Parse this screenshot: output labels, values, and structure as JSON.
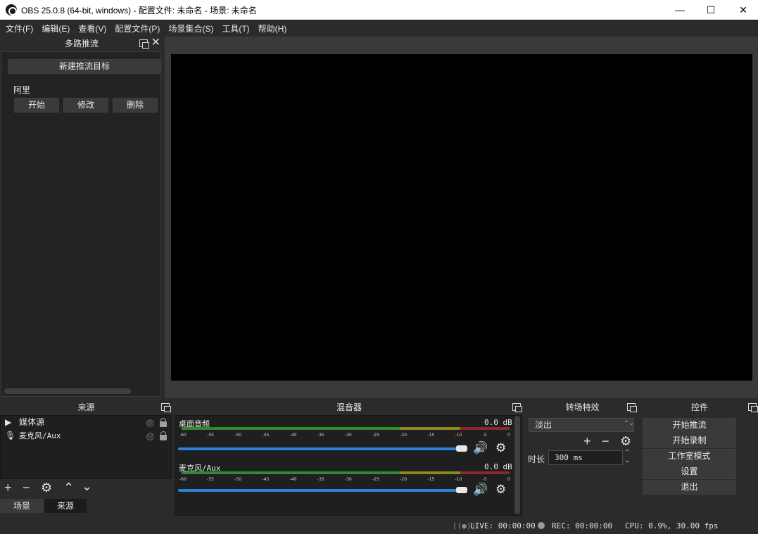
{
  "window": {
    "title": "OBS 25.0.8 (64-bit, windows) - 配置文件: 未命名 - 场景: 未命名",
    "minimize": "—",
    "maximize": "☐",
    "close": "✕"
  },
  "menu": [
    "文件(F)",
    "编辑(E)",
    "查看(V)",
    "配置文件(P)",
    "场景集合(S)",
    "工具(T)",
    "帮助(H)"
  ],
  "multistream": {
    "title": "多路推流",
    "new_target_button": "新建推流目标",
    "target_name": "阿里",
    "start_button": "开始",
    "edit_button": "修改",
    "delete_button": "删除"
  },
  "sources": {
    "title": "来源",
    "items": [
      {
        "label": "媒体源",
        "icon": "play-icon"
      },
      {
        "label": "麦克风/Aux",
        "icon": "microphone-icon"
      }
    ]
  },
  "bottom_tabs": [
    "场景",
    "来源"
  ],
  "mixer": {
    "title": "混音器",
    "channels": [
      {
        "name": "桌面音频",
        "db": "0.0 dB",
        "volume_fraction": 1.0
      },
      {
        "name": "麦克风/Aux",
        "db": "0.0 dB",
        "volume_fraction": 1.0
      }
    ],
    "ticks": [
      "-60",
      "-55",
      "-50",
      "-45",
      "-40",
      "-35",
      "-30",
      "-25",
      "-20",
      "-15",
      "-10",
      "-5",
      "0"
    ]
  },
  "transitions": {
    "title": "转场特效",
    "selected": "淡出",
    "duration_label": "时长",
    "duration_value": "300 ms"
  },
  "controls": {
    "title": "控件",
    "buttons": [
      "开始推流",
      "开始录制",
      "工作室模式",
      "设置",
      "退出"
    ]
  },
  "status": {
    "live": "LIVE: 00:00:00",
    "rec": "REC: 00:00:00",
    "cpu": "CPU: 0.9%, 30.00 fps"
  },
  "colors": {
    "background": "#2b2b2b",
    "preview": "#000000",
    "fader": "#2a82da"
  }
}
